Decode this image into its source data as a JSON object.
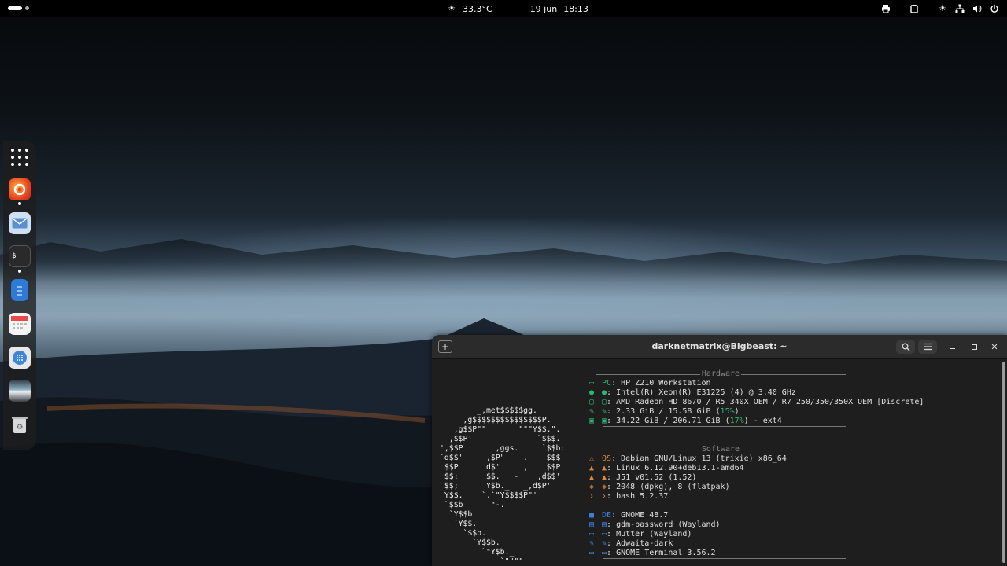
{
  "topbar": {
    "weather_temp": "33.3°C",
    "date": "19 jun",
    "time": "18:13"
  },
  "dock": {
    "items": [
      "apps-grid",
      "firefox",
      "mail",
      "terminal",
      "text-editor",
      "calendar",
      "software",
      "image-viewer",
      "trash"
    ]
  },
  "terminal": {
    "title": "darknetmatrix@Bigbeast: ~",
    "ascii_art": [
      "        _,met$$$$$gg.",
      "     ,g$$$$$$$$$$$$$$$P.",
      "   ,g$$P\"\"       \"\"\"Y$$.\".",
      "  ,$$P'              `$$$.",
      "',$$P       ,ggs.     `$$b:",
      "`d$$'     ,$P\"'   .    $$$",
      " $$P      d$'     ,    $$P",
      " $$:      $$.   -    ,d$$'",
      " $$;      Y$b._   _,d$P'",
      " Y$$.    `.`\"Y$$$$P\"'",
      " `$$b      \"-.__",
      "  `Y$$b",
      "   `Y$$.",
      "     `$$b.",
      "       `Y$$b.",
      "         `\"Y$b._",
      "             `\"\"\"\""
    ],
    "hardware_label": "Hardware",
    "hardware": [
      {
        "icon": "pc",
        "key": "PC",
        "value": "HP Z210 Workstation"
      },
      {
        "icon": "cpu",
        "key": "",
        "value": "Intel(R) Xeon(R) E31225 (4) @ 3.40 GHz"
      },
      {
        "icon": "gpu",
        "key": "",
        "value": "AMD Radeon HD 8670 / R5 340X OEM / R7 250/350/350X OEM [Discrete]"
      },
      {
        "icon": "memory",
        "key": "",
        "value_pre": "2.33 GiB / 15.58 GiB (",
        "pct": "15%",
        "value_post": ")"
      },
      {
        "icon": "disk",
        "key": "",
        "value_pre": "34.22 GiB / 206.71 GiB (",
        "pct": "17%",
        "value_post": ") - ext4"
      }
    ],
    "software_label": "Software",
    "software": [
      {
        "icon": "os",
        "key": "OS",
        "value": "Debian GNU/Linux 13 (trixie) x86_64"
      },
      {
        "icon": "kernel",
        "key": "",
        "value": "Linux 6.12.90+deb13.1-amd64"
      },
      {
        "icon": "kernel2",
        "key": "",
        "value": "J51 v01.52 (1.52)"
      },
      {
        "icon": "packages",
        "key": "",
        "value": "2048 (dpkg), 8 (flatpak)"
      },
      {
        "icon": "shell",
        "key": "",
        "value": "bash 5.2.37"
      }
    ],
    "desktop": [
      {
        "icon": "de",
        "key": "DE",
        "value": "GNOME 48.7"
      },
      {
        "icon": "lock",
        "key": "",
        "value": "gdm-password (Wayland)"
      },
      {
        "icon": "wm",
        "key": "",
        "value": "Mutter (Wayland)"
      },
      {
        "icon": "theme",
        "key": "",
        "value": "Adwaita-dark"
      },
      {
        "icon": "term",
        "key": "",
        "value": "GNOME Terminal 3.56.2"
      }
    ]
  }
}
